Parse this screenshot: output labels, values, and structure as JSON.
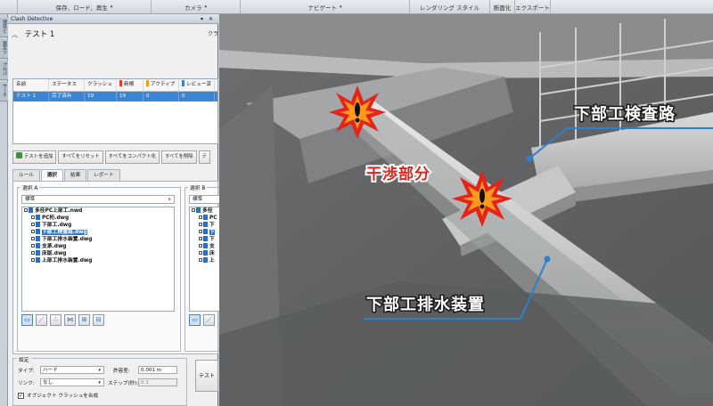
{
  "toolbar": {
    "groups": [
      {
        "label": "保存、ロード、再生",
        "w": 150
      },
      {
        "label": "カメラ",
        "w": 100
      },
      {
        "label": "ナビゲート",
        "w": 190
      },
      {
        "label": "レンダリング スタイル",
        "w": 90
      },
      {
        "label": "断面化",
        "w": 28
      },
      {
        "label": "エクスポート",
        "w": 40
      }
    ]
  },
  "side_tabs": [
    "保存ビュー",
    "測定ツール",
    "プロパティ",
    "サーチ"
  ],
  "panel": {
    "title": "Clash Detective",
    "controls": "▾ ✕",
    "test_name": "テスト 1",
    "header_right": "クラ",
    "grid": {
      "columns": [
        "名前",
        "ステータス",
        "クラッシュ",
        "新規",
        "アクティブ",
        "レビュー済"
      ],
      "row": [
        "テスト 1",
        "完了済み",
        "19",
        "19",
        "0",
        "0"
      ],
      "status_colors": {
        "new": "#e23b2e",
        "active": "#f29b21",
        "reviewed": "#3d7fd6"
      }
    },
    "buttons": [
      "テストを追加",
      "すべてをリセット",
      "すべてをコンパクト化",
      "すべてを削除",
      "テ"
    ],
    "tabs": [
      "ルール",
      "選択",
      "結果",
      "レポート"
    ],
    "active_tab": "選択",
    "select_a": {
      "label": "選択 A",
      "dropdown": "標準",
      "tree": [
        {
          "t": "多径PC上部工.nwd",
          "lvl": 0,
          "sel": false
        },
        {
          "t": "PC桁.dwg",
          "lvl": 1,
          "sel": false
        },
        {
          "t": "下部工.dwg",
          "lvl": 1,
          "sel": false
        },
        {
          "t": "下部工検査路.dwg",
          "lvl": 1,
          "sel": true
        },
        {
          "t": "下部工排水装置.dwg",
          "lvl": 1,
          "sel": false
        },
        {
          "t": "支承.dwg",
          "lvl": 1,
          "sel": false
        },
        {
          "t": "床版.dwg",
          "lvl": 1,
          "sel": false
        },
        {
          "t": "上部工排水装置.dwg",
          "lvl": 1,
          "sel": false
        }
      ]
    },
    "select_b": {
      "label": "選択 B",
      "dropdown": "標準",
      "tree": [
        {
          "t": "多径",
          "lvl": 0,
          "sel": false
        },
        {
          "t": "PC",
          "lvl": 1,
          "sel": false
        },
        {
          "t": "下",
          "lvl": 1,
          "sel": false
        },
        {
          "t": "下",
          "lvl": 1,
          "sel": true
        },
        {
          "t": "下",
          "lvl": 1,
          "sel": false
        },
        {
          "t": "支",
          "lvl": 1,
          "sel": false
        },
        {
          "t": "床",
          "lvl": 1,
          "sel": false
        },
        {
          "t": "上",
          "lvl": 1,
          "sel": false
        }
      ]
    },
    "settings": {
      "label": "設定",
      "type_label": "タイプ:",
      "type_value": "ハード",
      "tolerance_label": "許容差:",
      "tolerance_value": "0.001 m",
      "link_label": "リンク:",
      "link_value": "なし",
      "step_label": "ステップ(秒):",
      "step_value": "0.1",
      "checkbox_label": "オブジェクト クラッシュを合成"
    },
    "test_button": "テスト"
  },
  "viewport": {
    "callout_inspection": "下部工検査路",
    "callout_interference": "干渉部分",
    "callout_drainage": "下部工排水装置",
    "accent": "#2f7fd0"
  }
}
